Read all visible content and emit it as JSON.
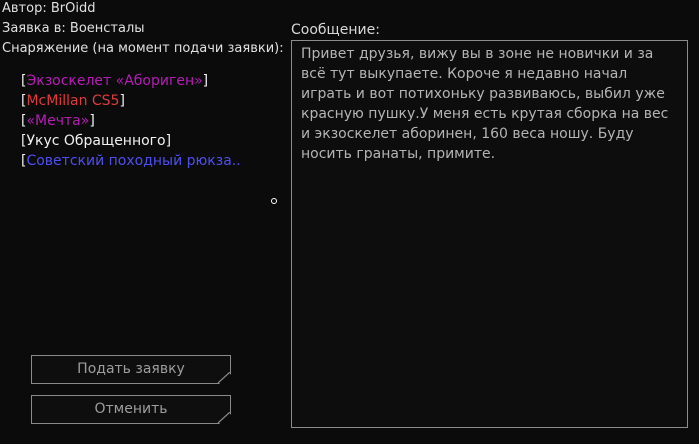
{
  "author_line": "Автор: BrOidd",
  "application_line": "Заявка в: Военсталы",
  "equipment_title": "Снаряжение (на момент подачи заявки):",
  "equipment": [
    {
      "name": "Экзоскелет «Абориген»",
      "color": "#b51db5"
    },
    {
      "name": "McMillan CS5",
      "color": "#e03b3b"
    },
    {
      "name": "«Мечта»",
      "color": "#b51db5"
    },
    {
      "name": "Укус Обращенного",
      "color": "#f0f0f0"
    },
    {
      "name": "Советский походный рюкза..",
      "color": "#4f4ff0"
    }
  ],
  "message_title": "Сообщение:",
  "message_text": "Привет друзья, вижу вы в зоне не новички и за всё тут выкупаете. Короче я недавно начал играть и вот потихоньку развиваюсь, выбил уже красную пушку.У меня есть крутая сборка на вес и экзоскелет аборинен, 160 веса ношу. Буду носить гранаты, примите.",
  "buttons": {
    "submit_label": "Подать заявку",
    "cancel_label": "Отменить"
  }
}
